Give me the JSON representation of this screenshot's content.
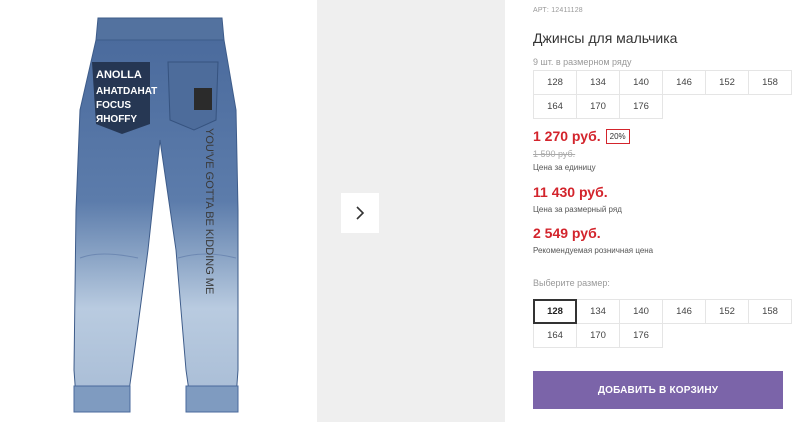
{
  "product": {
    "article": "АРТ: 12411128",
    "title": "Джинсы для мальчика",
    "pack_label": "9 шт. в размерном ряду",
    "pack_sizes": [
      "128",
      "134",
      "140",
      "146",
      "152",
      "158",
      "164",
      "170",
      "176"
    ],
    "price": "1 270 руб.",
    "discount": "20%",
    "old_price": "1 590 руб.",
    "unit_label": "Цена за единицу",
    "series_price": "11 430 руб.",
    "series_label": "Цена за размерный ряд",
    "retail_price": "2 549 руб.",
    "retail_label": "Рекомендуемая розничная цена",
    "choose_label": "Выберите размер:",
    "choose_sizes": [
      "128",
      "134",
      "140",
      "146",
      "152",
      "158",
      "164",
      "170",
      "176"
    ],
    "selected_size": "128",
    "add_button": "ДОБАВИТЬ В КОРЗИНУ"
  },
  "gallery": {
    "next_icon": "chevron-right-icon",
    "print_left": [
      "ANOLLA",
      "AHATDAHAT",
      "FOCUS",
      "ЯHOFFY"
    ],
    "print_leg": "YOU'VE GOTTA BE KIDDING ME"
  },
  "colors": {
    "price_red": "#d3242c",
    "button_purple": "#7b64a9",
    "denim_dark": "#4a6a9c",
    "denim_light": "#b7c9df"
  }
}
